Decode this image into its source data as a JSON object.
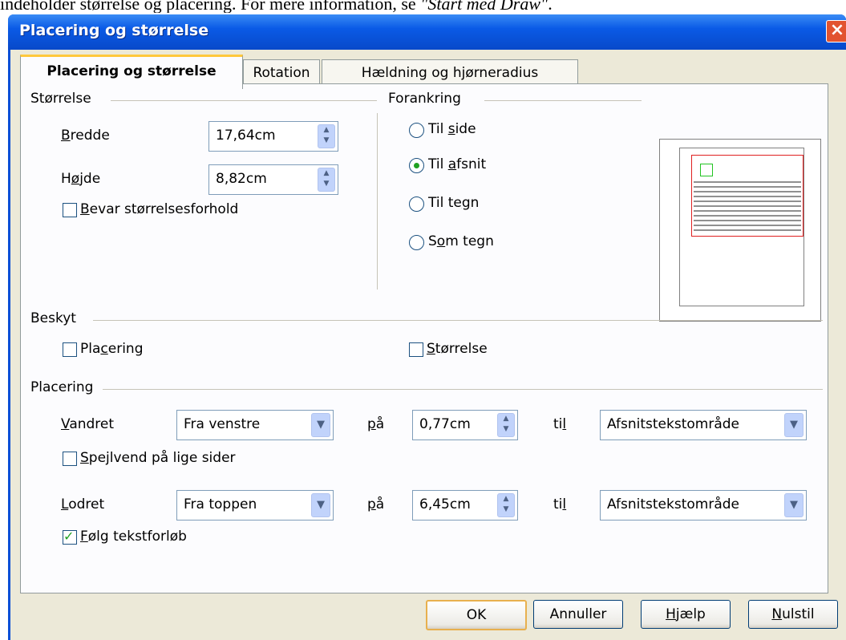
{
  "document_text": {
    "before": "indeholder størrelse og placering. For mere information, se ",
    "italic": "\"Start med Draw\"",
    "after": "."
  },
  "title": "Placering og størrelse",
  "tabs": [
    {
      "label": "Placering og størrelse",
      "active": true
    },
    {
      "label": "Rotation",
      "active": false
    },
    {
      "label": "Hældning og hjørneradius",
      "active": false
    }
  ],
  "size_section": {
    "heading": "Størrelse",
    "width_label": "Bredde",
    "width_value": "17,64cm",
    "height_label": "Højde",
    "height_value": "8,82cm",
    "keep_ratio_label": "Bevar størrelsesforhold",
    "keep_ratio_checked": false
  },
  "anchor_section": {
    "heading": "Forankring",
    "options": [
      {
        "label": "Til side",
        "selected": false
      },
      {
        "label": "Til afsnit",
        "selected": true
      },
      {
        "label": "Til tegn",
        "selected": false
      },
      {
        "label": "Som tegn",
        "selected": false
      }
    ]
  },
  "protect_section": {
    "heading": "Beskyt",
    "position_label": "Placering",
    "size_label": "Størrelse"
  },
  "position_section": {
    "heading": "Placering",
    "horizontal_label": "Vandret",
    "horizontal_value": "Fra venstre",
    "by_label": "på",
    "horizontal_by": "0,77cm",
    "to_label": "til",
    "horizontal_to": "Afsnitstekstområde",
    "mirror_label": "Spejlvend på lige sider",
    "vertical_label": "Lodret",
    "vertical_value": "Fra toppen",
    "vertical_by": "6,45cm",
    "vertical_to": "Afsnitstekstområde",
    "follow_flow_label": "Følg tekstforløb",
    "follow_flow_checked": true
  },
  "buttons": {
    "ok": "OK",
    "cancel": "Annuller",
    "help": "Hjælp",
    "reset": "Nulstil"
  }
}
